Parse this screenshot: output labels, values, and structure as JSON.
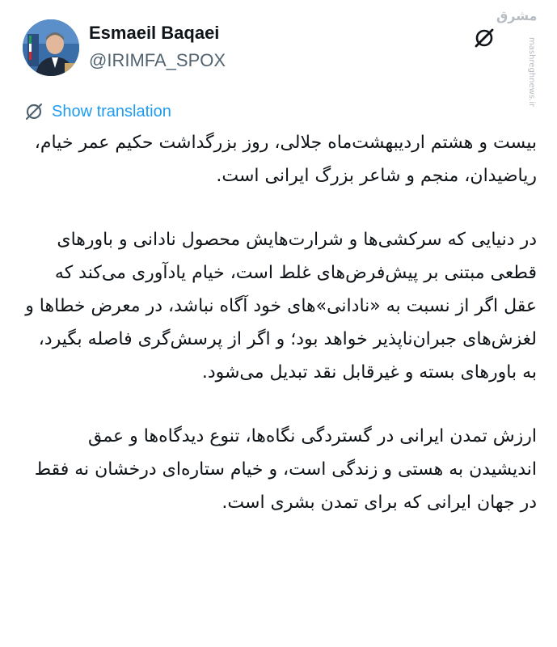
{
  "author": {
    "display_name": "Esmaeil Baqaei",
    "handle": "@IRIMFA_SPOX",
    "avatar_icon": "avatar-photo"
  },
  "watermark": {
    "logo_text": "مشرق",
    "url": "mashreghnews.ir"
  },
  "actions": {
    "grok_icon": "grok-icon",
    "translation_icon": "translate-globe-icon",
    "show_translation": "Show translation"
  },
  "tweet": {
    "paragraphs": [
      "بیست و هشتم اردیبهشت‌ماه جلالی، روز بزرگداشت حکیم عمر خیام، ریاضیدان، منجم و شاعر بزرگ ایرانی است.",
      "در دنیایی که سرکشی‌ها و شرارت‌هایش محصول نادانی و باورهای قطعی مبتنی بر پیش‌فرض‌های غلط است، خیام یادآوری می‌کند که عقل اگر از نسبت به «نادانی»‌های خود آگاه نباشد، در معرض خطاها و لغزش‌های جبران‌ناپذیر خواهد بود؛ و اگر از پرسش‌گری فاصله بگیرد، به باورهای بسته و غیرقابل نقد تبدیل می‌شود.",
      "ارزش تمدن ایرانی در گستردگی نگاه‌ها، تنوع دیدگاه‌ها و عمق اندیشیدن به هستی و زندگی است، و خیام ستاره‌ای درخشان نه فقط در جهان ایرانی که برای تمدن بشری است."
    ]
  },
  "colors": {
    "text": "#0f1419",
    "secondary": "#536471",
    "link": "#1d9bf0",
    "background": "#ffffff"
  }
}
